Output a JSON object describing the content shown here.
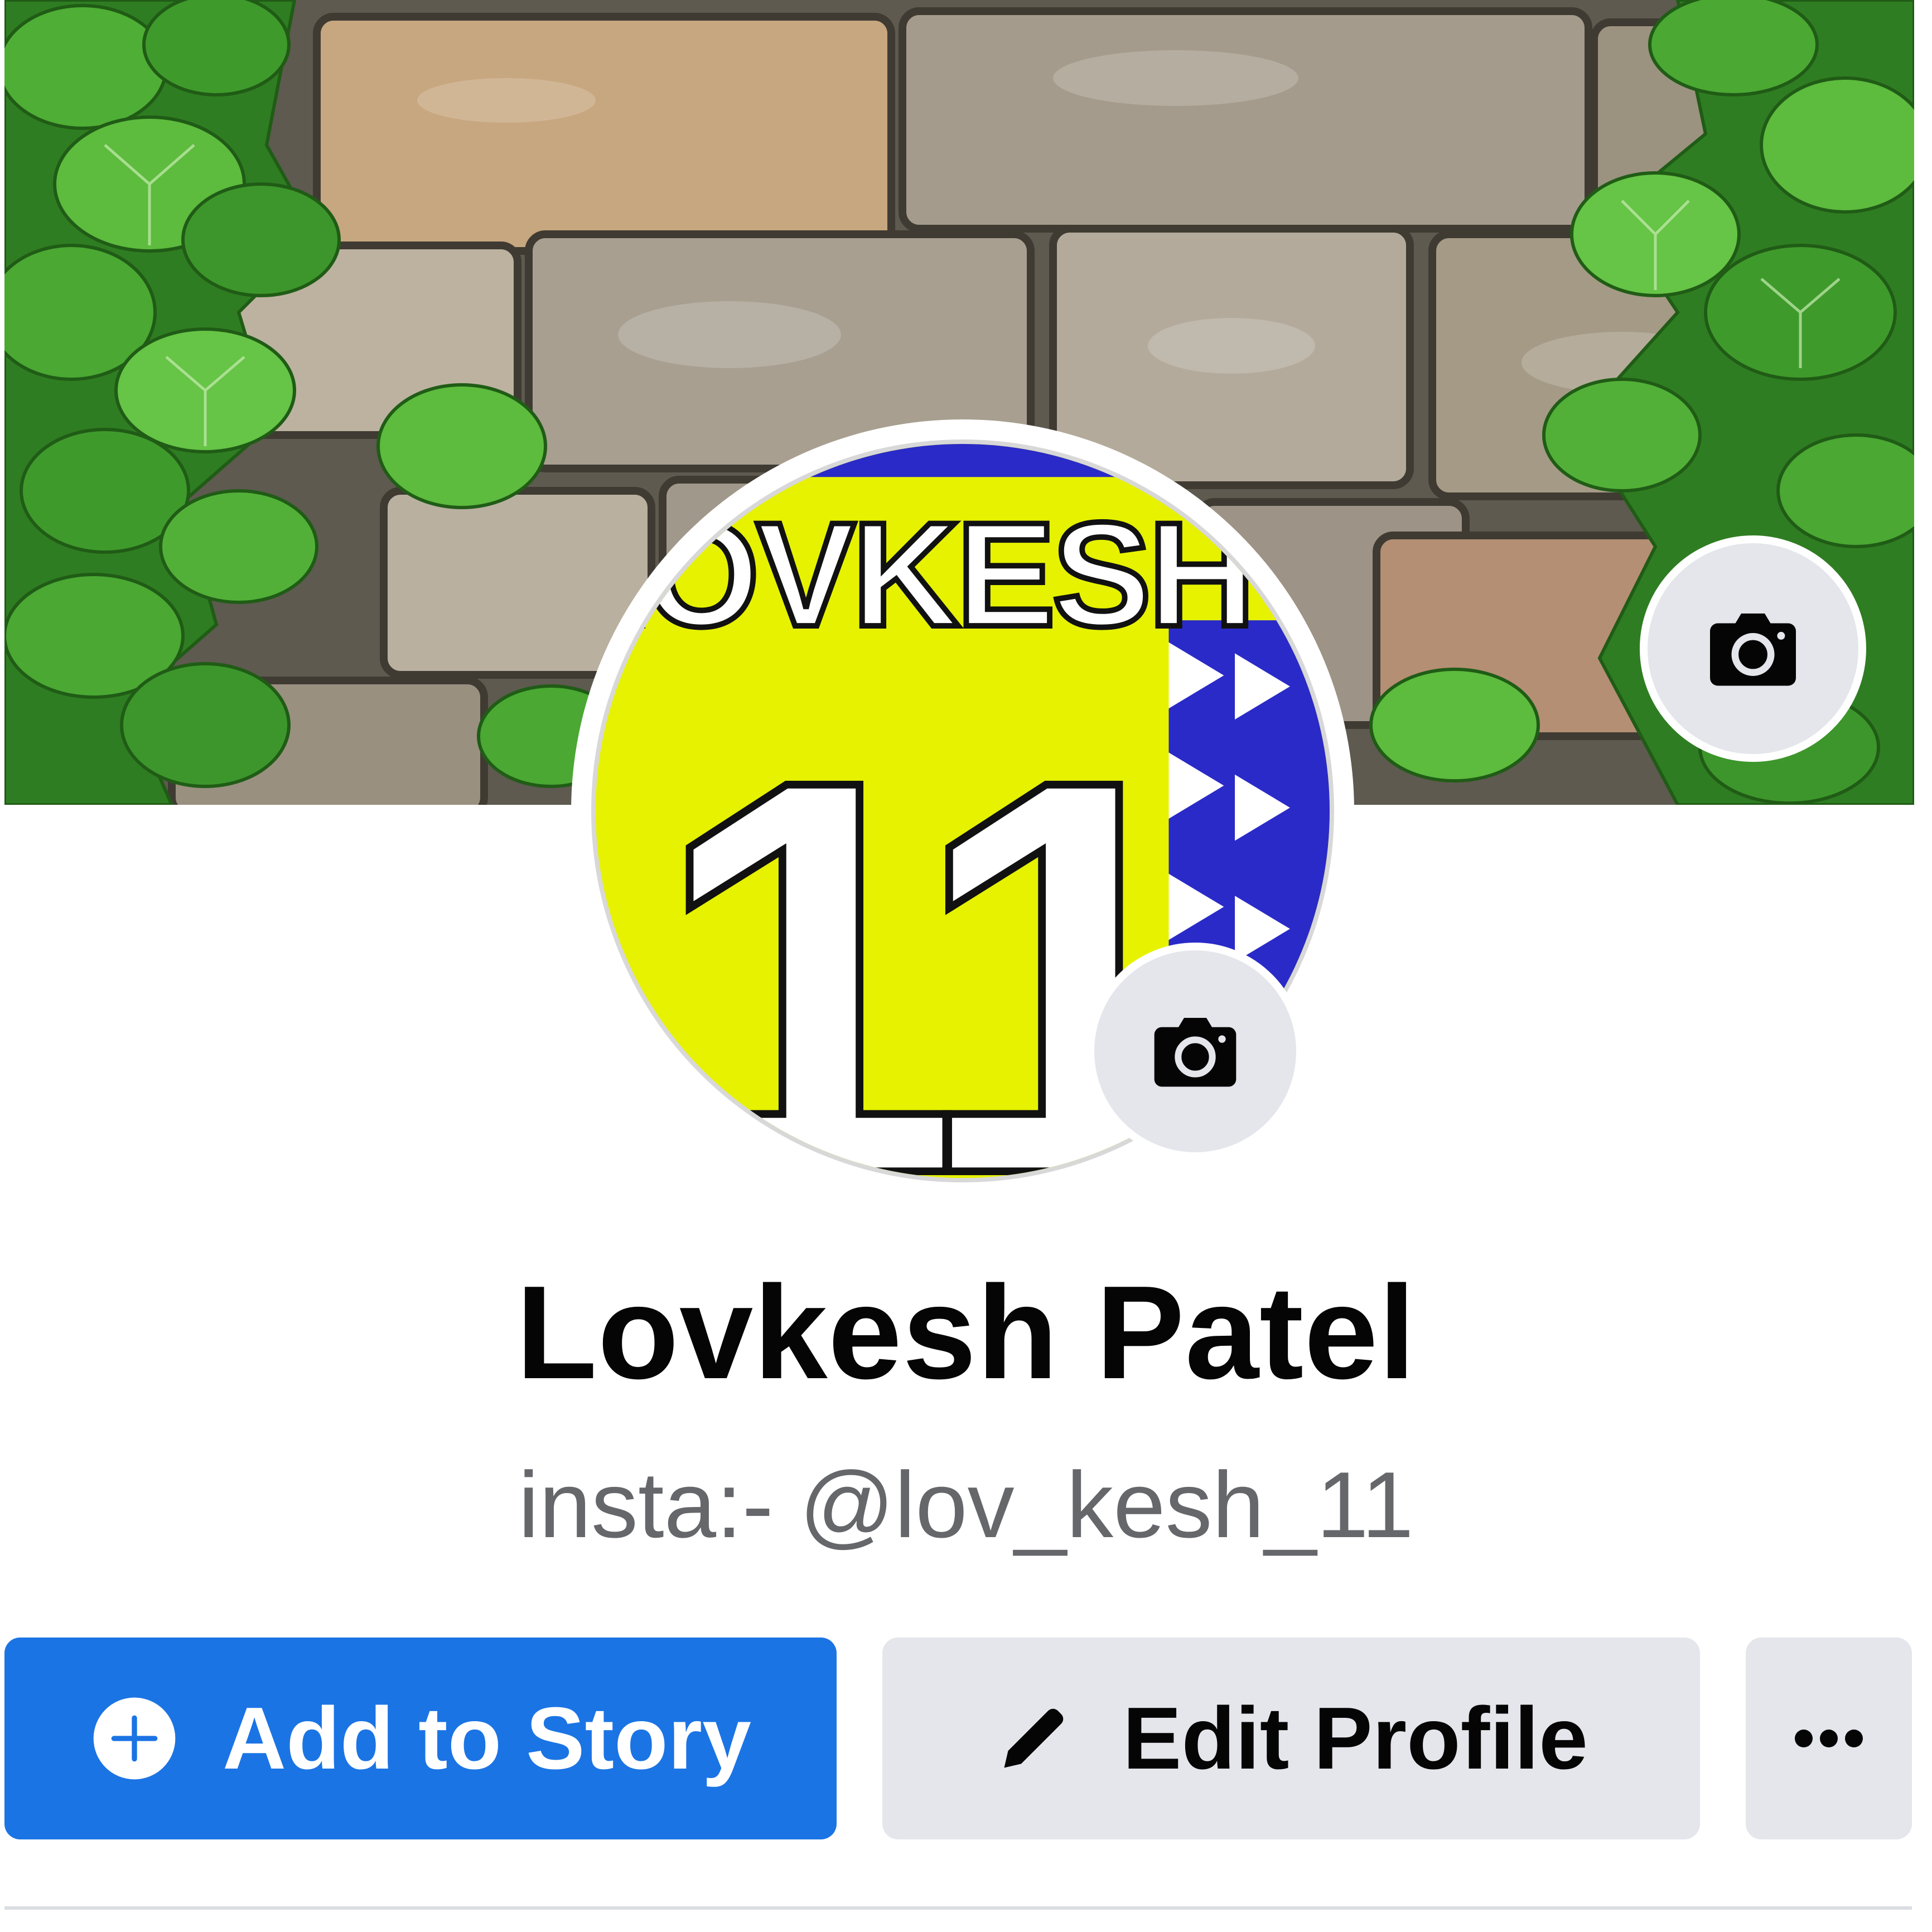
{
  "profile": {
    "name": "Lovkesh Patel",
    "bio": "insta:- @lov_kesh_11"
  },
  "avatar": {
    "jersey_text": "LOVKESH",
    "jersey_number": "11"
  },
  "actions": {
    "add_story_label": "Add to Story",
    "edit_profile_label": "Edit Profile"
  },
  "icons": {
    "cover_camera": "camera-icon",
    "avatar_camera": "camera-icon",
    "add_story": "plus-circle-icon",
    "edit_profile": "pencil-icon",
    "more": "more-dots-icon"
  },
  "colors": {
    "primary_button": "#1b74e4",
    "secondary_button": "#e4e6eb",
    "name_text": "#050505",
    "bio_text": "#65676b",
    "jersey_yellow": "#e6f200",
    "jersey_blue": "#2a2ac8"
  }
}
